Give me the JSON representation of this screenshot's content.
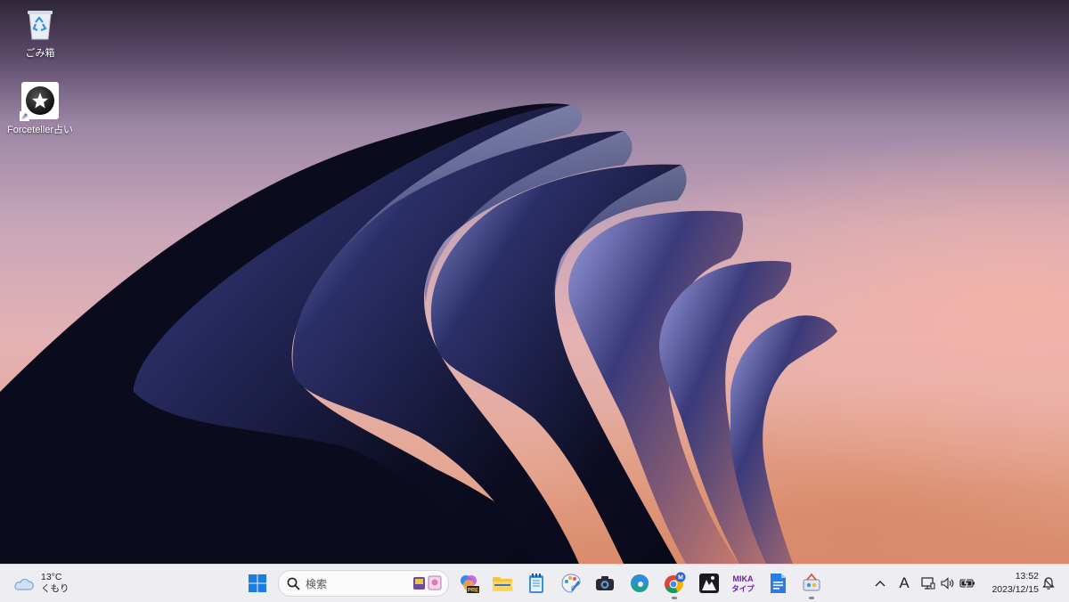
{
  "desktop": {
    "icons": [
      {
        "label": "ごみ箱",
        "icon": "recycle-bin-icon"
      },
      {
        "label": "Forceteller占い",
        "icon": "forceteller-app-icon"
      }
    ]
  },
  "taskbar": {
    "weather": {
      "temperature": "13°C",
      "condition": "くもり",
      "icon": "cloud-icon"
    },
    "search": {
      "placeholder": "検索"
    },
    "pinned_apps": [
      "start-icon",
      "copilot-pre-icon",
      "file-explorer-icon",
      "notepad-icon",
      "paint-icon",
      "camera-icon",
      "edge-icon",
      "chrome-icon",
      "dark-app-icon",
      "mika-type-icon",
      "word-doc-icon",
      "settings-app-icon"
    ],
    "chrome_badge": "M",
    "mika_label_top": "MIKA",
    "mika_label_bottom": "タイプ",
    "copilot_badge": "PRE",
    "tray": {
      "ime_mode": "A",
      "clock_time": "13:52",
      "clock_date": "2023/12/15"
    }
  },
  "colors": {
    "taskbar_bg": "#eeedf2",
    "accent_blue": "#0a64d6"
  }
}
